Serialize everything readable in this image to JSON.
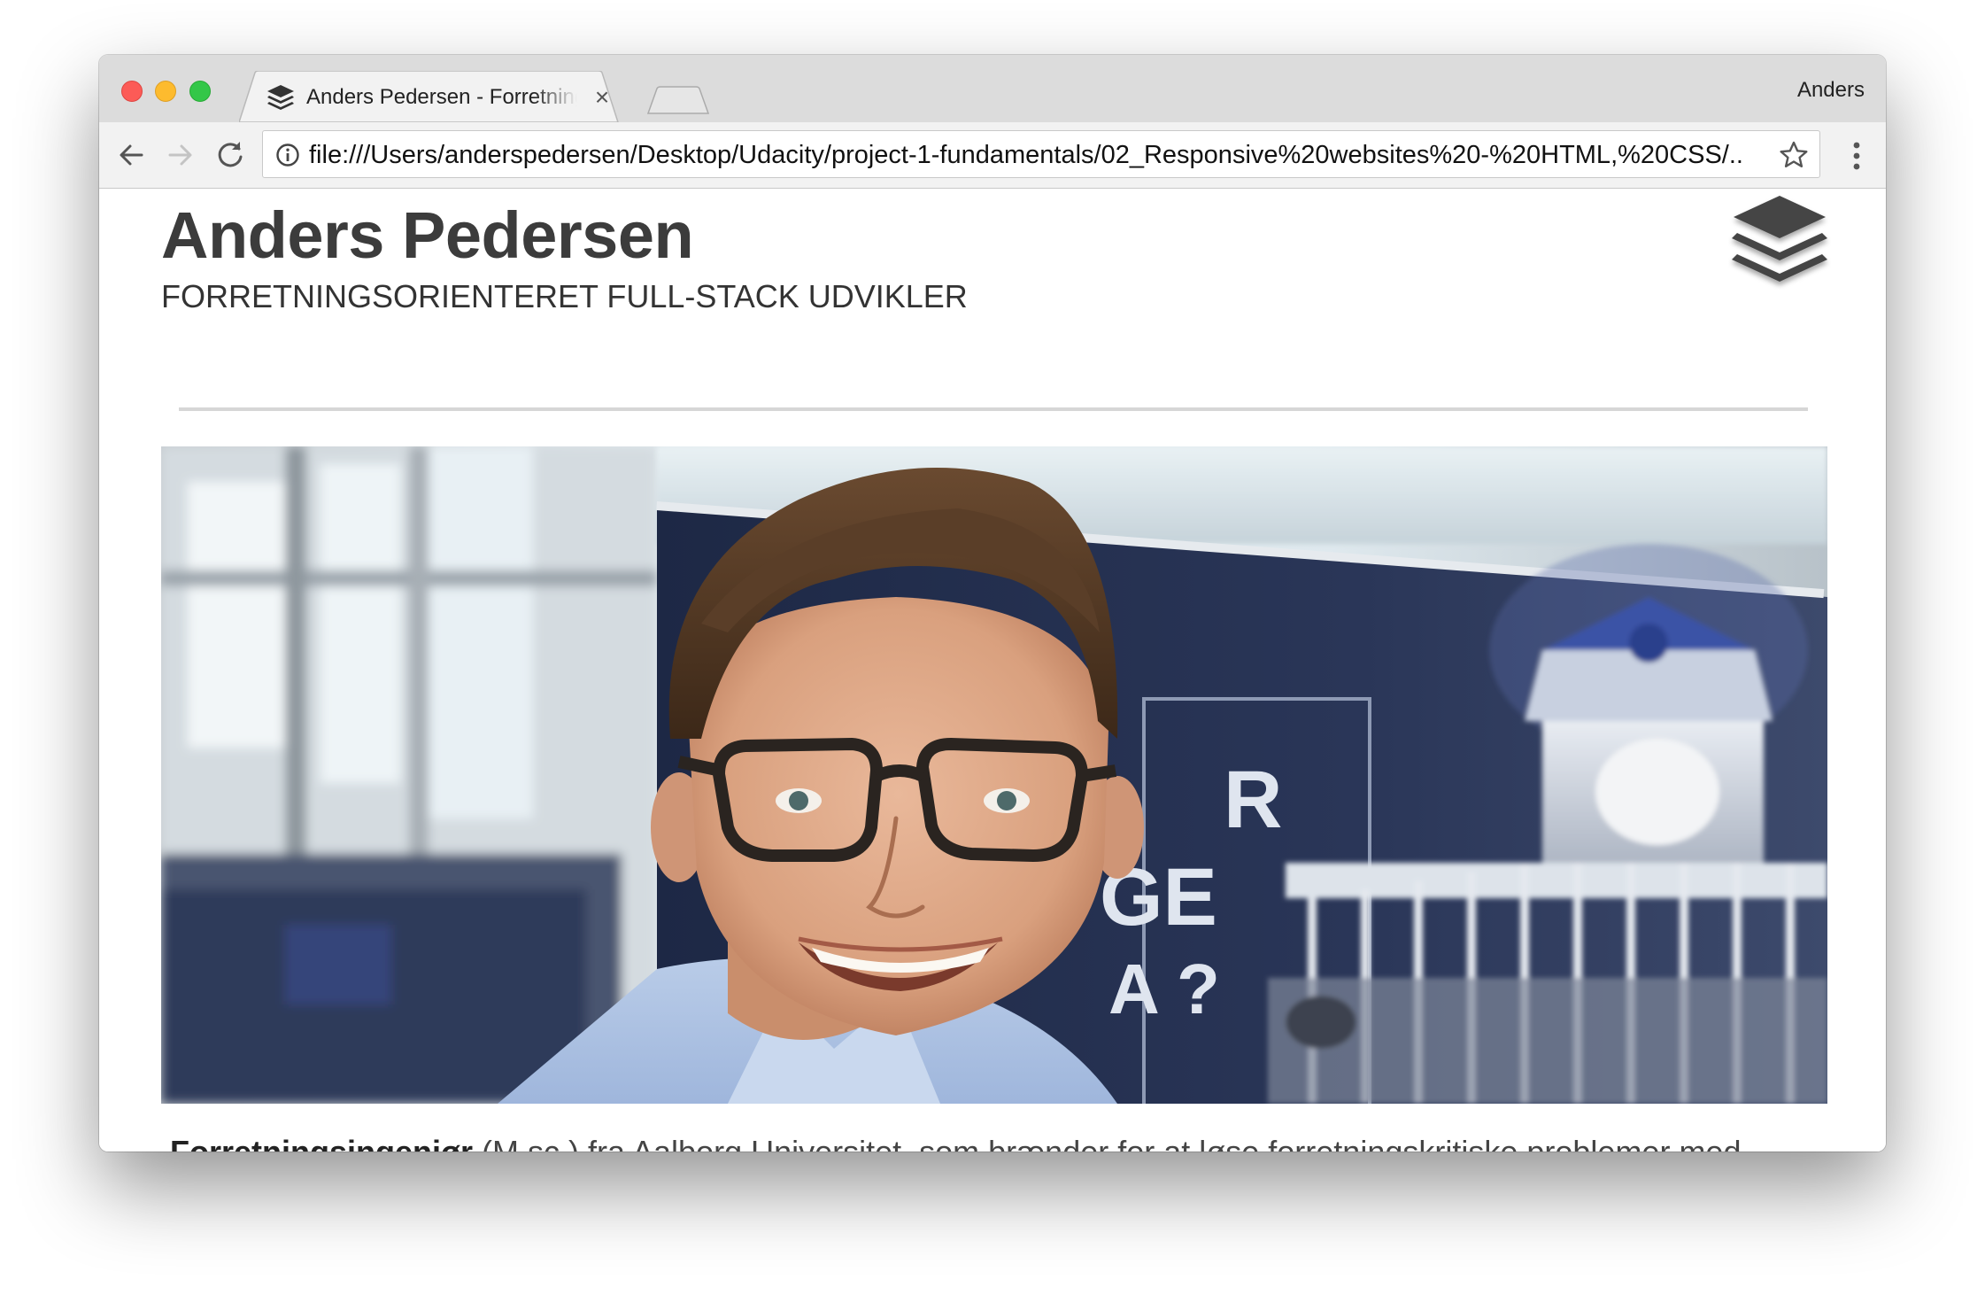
{
  "browser": {
    "tab_title": "Anders Pedersen - Forretningsorienteret full-stack udvikler",
    "tab_close_glyph": "×",
    "profile_name": "Anders",
    "url": "file:///Users/anderspedersen/Desktop/Udacity/project-1-fundamentals/02_Responsive%20websites%20-%20HTML,%20CSS/...",
    "icons": [
      "back-arrow-icon",
      "forward-arrow-icon",
      "reload-icon",
      "info-icon",
      "star-icon",
      "menu-icon",
      "layers-icon"
    ]
  },
  "page": {
    "title": "Anders Pedersen",
    "subtitle": "FORRETNINGSORIENTERET FULL-STACK UDVIKLER",
    "intro_bold": "Forretningsingeniør",
    "intro_text": " (M.sc.) fra Aalborg Universitet, som brænder for at løse forretningskritiske problemer med kode. Jeg har erfaring med:",
    "hero_banner_letters": [
      "R",
      "GE",
      "A ?"
    ]
  },
  "colors": {
    "tabstrip_bg": "#dcdcdc",
    "toolbar_bg": "#f2f2f2",
    "heading": "#3c3c3c",
    "divider": "#d6d6d6",
    "close": "#fc5b57",
    "minimize": "#fdbb2e",
    "maximize": "#33c748"
  }
}
